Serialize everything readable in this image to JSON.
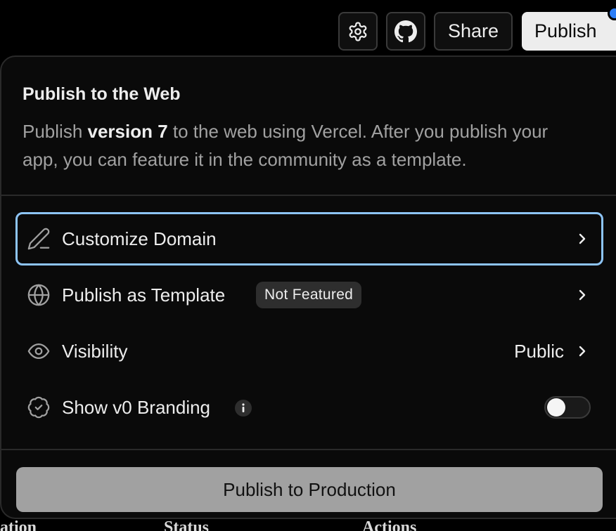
{
  "toolbar": {
    "share_label": "Share",
    "publish_label": "Publish",
    "settings_icon": "gear-icon",
    "github_icon": "github-icon"
  },
  "panel": {
    "title": "Publish to the Web",
    "description": {
      "part1": "Publish ",
      "version": "version 7",
      "part2": " to the web using Vercel. After you publish your app, you can feature it in the community as a template."
    },
    "rows": {
      "customize": {
        "label": "Customize Domain",
        "icon": "pencil-icon"
      },
      "template": {
        "label": "Publish as Template",
        "badge": "Not Featured",
        "icon": "globe-icon"
      },
      "visibility": {
        "label": "Visibility",
        "value": "Public",
        "icon": "eye-icon"
      },
      "branding": {
        "label": "Show v0 Branding",
        "icon": "badge-check-icon",
        "toggle_on": false
      }
    },
    "production_button": "Publish to Production"
  },
  "background_page": {
    "col1": "ation",
    "col2": "Status",
    "col3": "Actions"
  },
  "colors": {
    "accent_focus": "#8dc4f5",
    "notify_dot": "#2b7df7",
    "panel_bg": "#0a0a0a",
    "production_button_bg": "#a1a1a1"
  }
}
